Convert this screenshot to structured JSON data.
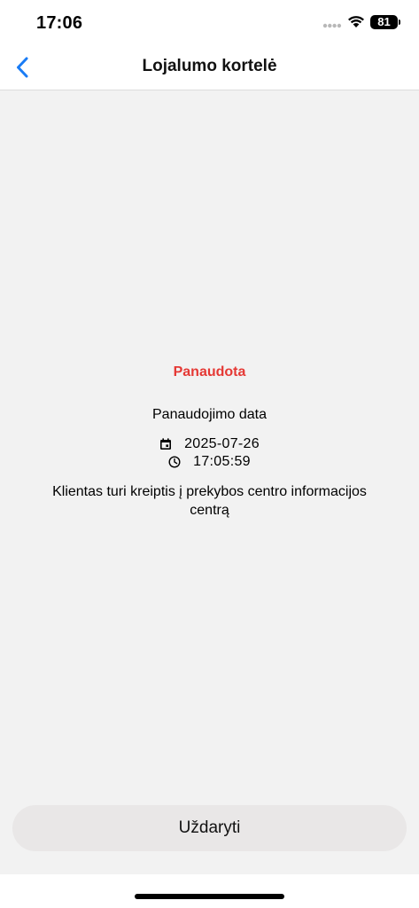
{
  "status_bar": {
    "time": "17:06",
    "battery_level": "81",
    "icons": [
      "signal-dots-icon",
      "wifi-icon",
      "battery-icon"
    ]
  },
  "nav": {
    "back_icon": "chevron-left-icon",
    "title": "Lojalumo kortelė"
  },
  "content": {
    "status_label": "Panaudota",
    "date_heading": "Panaudojimo data",
    "date_icon": "calendar-icon",
    "date_value": "2025-07-26",
    "time_icon": "clock-icon",
    "time_value": "17:05:59",
    "message": "Klientas turi kreiptis į prekybos centro informacijos centrą"
  },
  "footer": {
    "close_label": "Uždaryti"
  },
  "colors": {
    "accent": "#1a7cf5",
    "status_red": "#e53935",
    "background": "#f2f2f2",
    "button_bg": "#e9e7e7"
  }
}
